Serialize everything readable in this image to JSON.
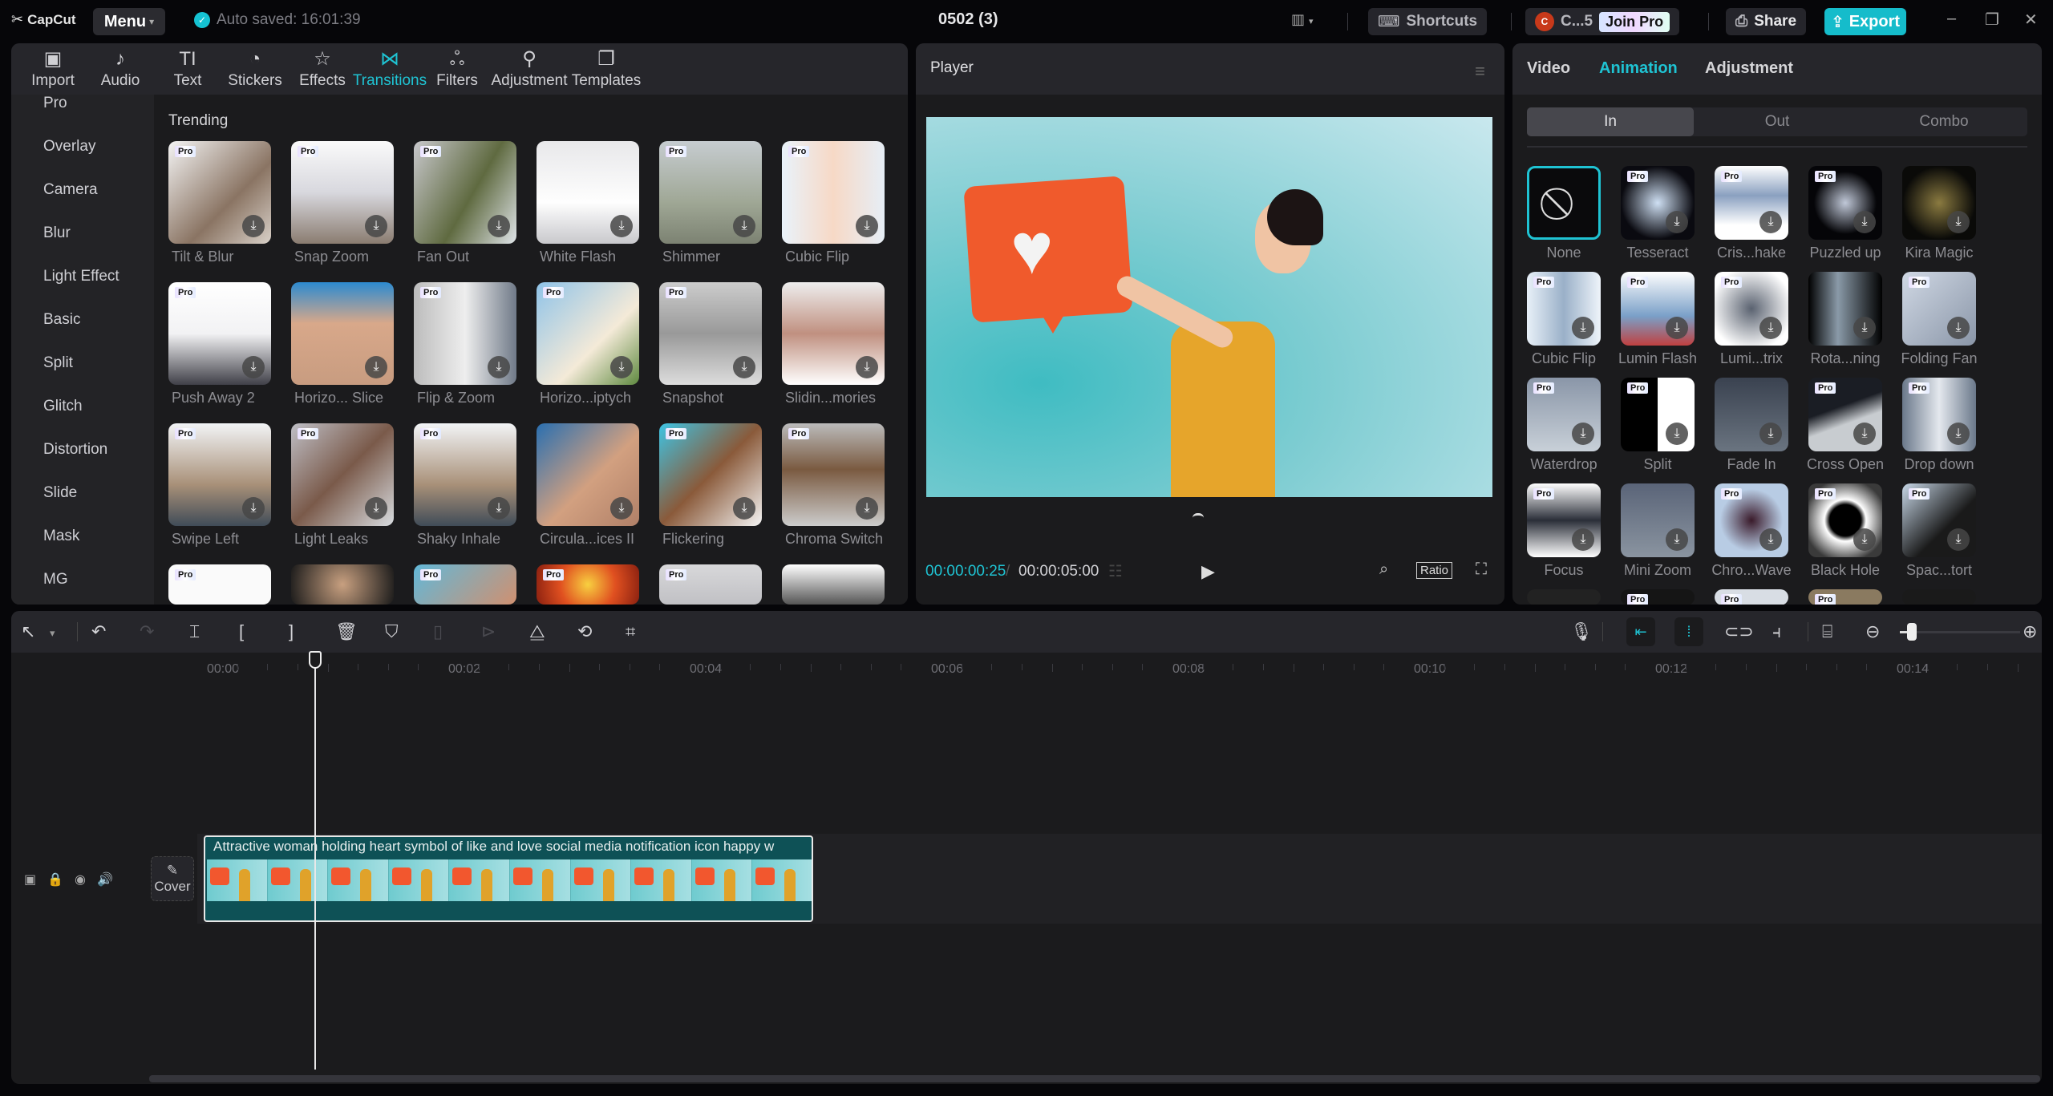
{
  "app": {
    "name": "CapCut",
    "menu_label": "Menu",
    "autosave": "Auto saved: 16:01:39",
    "project_title": "0502 (3)",
    "shortcuts_label": "Shortcuts",
    "account_initial": "C",
    "account_name": "C...5",
    "join_pro_label": "Join Pro",
    "share_label": "Share",
    "export_label": "Export",
    "accent_color": "#1fc3d3"
  },
  "toolbar": {
    "tabs": [
      {
        "label": "Import",
        "icon": "import-icon"
      },
      {
        "label": "Audio",
        "icon": "audio-icon"
      },
      {
        "label": "Text",
        "icon": "text-icon"
      },
      {
        "label": "Stickers",
        "icon": "stickers-icon"
      },
      {
        "label": "Effects",
        "icon": "effects-icon"
      },
      {
        "label": "Transitions",
        "icon": "transitions-icon",
        "active": true
      },
      {
        "label": "Filters",
        "icon": "filters-icon"
      },
      {
        "label": "Adjustment",
        "icon": "adjustment-icon"
      },
      {
        "label": "Templates",
        "icon": "templates-icon"
      }
    ]
  },
  "categories": [
    "Pro",
    "Overlay",
    "Camera",
    "Blur",
    "Light Effect",
    "Basic",
    "Split",
    "Glitch",
    "Distortion",
    "Slide",
    "Mask",
    "MG"
  ],
  "transitions": {
    "section_title": "Trending",
    "items": [
      {
        "label": "Tilt & Blur",
        "pro": true
      },
      {
        "label": "Snap Zoom",
        "pro": true
      },
      {
        "label": "Fan Out",
        "pro": true
      },
      {
        "label": "White Flash",
        "pro": false
      },
      {
        "label": "Shimmer",
        "pro": true
      },
      {
        "label": "Cubic Flip",
        "pro": true
      },
      {
        "label": "Push Away 2",
        "pro": true
      },
      {
        "label": "Horizo... Slice",
        "pro": false
      },
      {
        "label": "Flip & Zoom",
        "pro": true
      },
      {
        "label": "Horizo...iptych",
        "pro": true
      },
      {
        "label": "Snapshot",
        "pro": true
      },
      {
        "label": "Slidin...mories",
        "pro": false
      },
      {
        "label": "Swipe Left",
        "pro": true
      },
      {
        "label": "Light Leaks",
        "pro": true
      },
      {
        "label": "Shaky Inhale",
        "pro": true
      },
      {
        "label": "Circula...ices II",
        "pro": false
      },
      {
        "label": "Flickering",
        "pro": true
      },
      {
        "label": "Chroma Switch",
        "pro": true
      },
      {
        "label": "",
        "pro": true
      },
      {
        "label": "",
        "pro": false
      },
      {
        "label": "",
        "pro": true
      },
      {
        "label": "",
        "pro": true
      },
      {
        "label": "",
        "pro": true
      },
      {
        "label": "",
        "pro": false
      }
    ]
  },
  "player": {
    "title": "Player",
    "current_time": "00:00:00:25",
    "duration": "00:00:05:00",
    "ratio_label": "Ratio"
  },
  "inspector": {
    "tabs": [
      "Video",
      "Animation",
      "Adjustment"
    ],
    "active_tab": "Animation",
    "segments": [
      "In",
      "Out",
      "Combo"
    ],
    "active_segment": "In",
    "animations": [
      {
        "label": "None",
        "pro": false,
        "selected": true
      },
      {
        "label": "Tesseract",
        "pro": true
      },
      {
        "label": "Cris...hake",
        "pro": true
      },
      {
        "label": "Puzzled up",
        "pro": true
      },
      {
        "label": "Kira Magic",
        "pro": false
      },
      {
        "label": "Cubic Flip",
        "pro": true
      },
      {
        "label": "Lumin Flash",
        "pro": true
      },
      {
        "label": "Lumi...trix",
        "pro": true
      },
      {
        "label": "Rota...ning",
        "pro": false
      },
      {
        "label": "Folding Fan",
        "pro": true
      },
      {
        "label": "Waterdrop",
        "pro": true
      },
      {
        "label": "Split",
        "pro": true
      },
      {
        "label": "Fade In",
        "pro": false
      },
      {
        "label": "Cross Open",
        "pro": true
      },
      {
        "label": "Drop down",
        "pro": true
      },
      {
        "label": "Focus",
        "pro": true
      },
      {
        "label": "Mini Zoom",
        "pro": false
      },
      {
        "label": "Chro...Wave",
        "pro": true
      },
      {
        "label": "Black Hole",
        "pro": true
      },
      {
        "label": "Spac...tort",
        "pro": true
      },
      {
        "label": "",
        "pro": false
      },
      {
        "label": "",
        "pro": true
      },
      {
        "label": "",
        "pro": true
      },
      {
        "label": "",
        "pro": true
      },
      {
        "label": "",
        "pro": false
      }
    ]
  },
  "timeline": {
    "ruler_ticks": [
      "00:00",
      "00:02",
      "00:04",
      "00:06",
      "00:08",
      "00:10",
      "00:12",
      "00:14"
    ],
    "clip_title": "Attractive woman holding heart symbol of like and love social media notification icon happy w",
    "cover_label": "Cover",
    "zoom_level": 0.1
  }
}
